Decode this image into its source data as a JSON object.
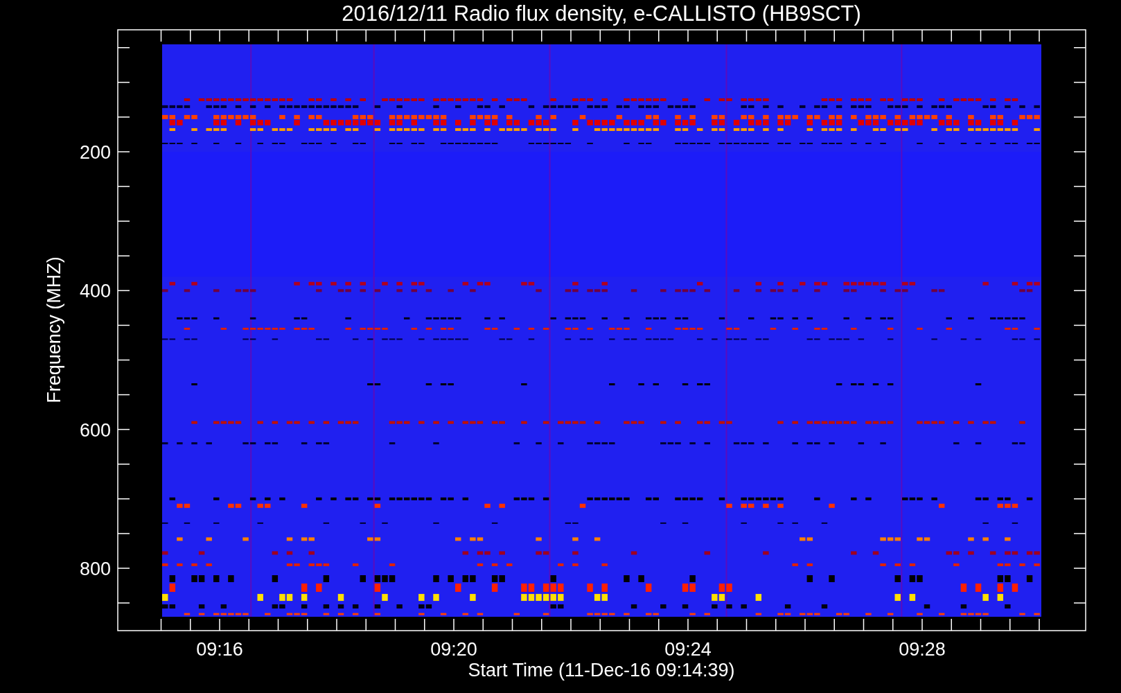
{
  "title": "2016/12/11  Radio flux density, e-CALLISTO (HB9SCT)",
  "y_axis": {
    "label": "Frequency (MHZ)",
    "ticks": [
      "200",
      "400",
      "600",
      "800"
    ]
  },
  "x_axis": {
    "label": "Start Time (11-Dec-16 09:14:39)",
    "ticks": [
      "09:16",
      "09:20",
      "09:24",
      "09:28"
    ]
  }
}
